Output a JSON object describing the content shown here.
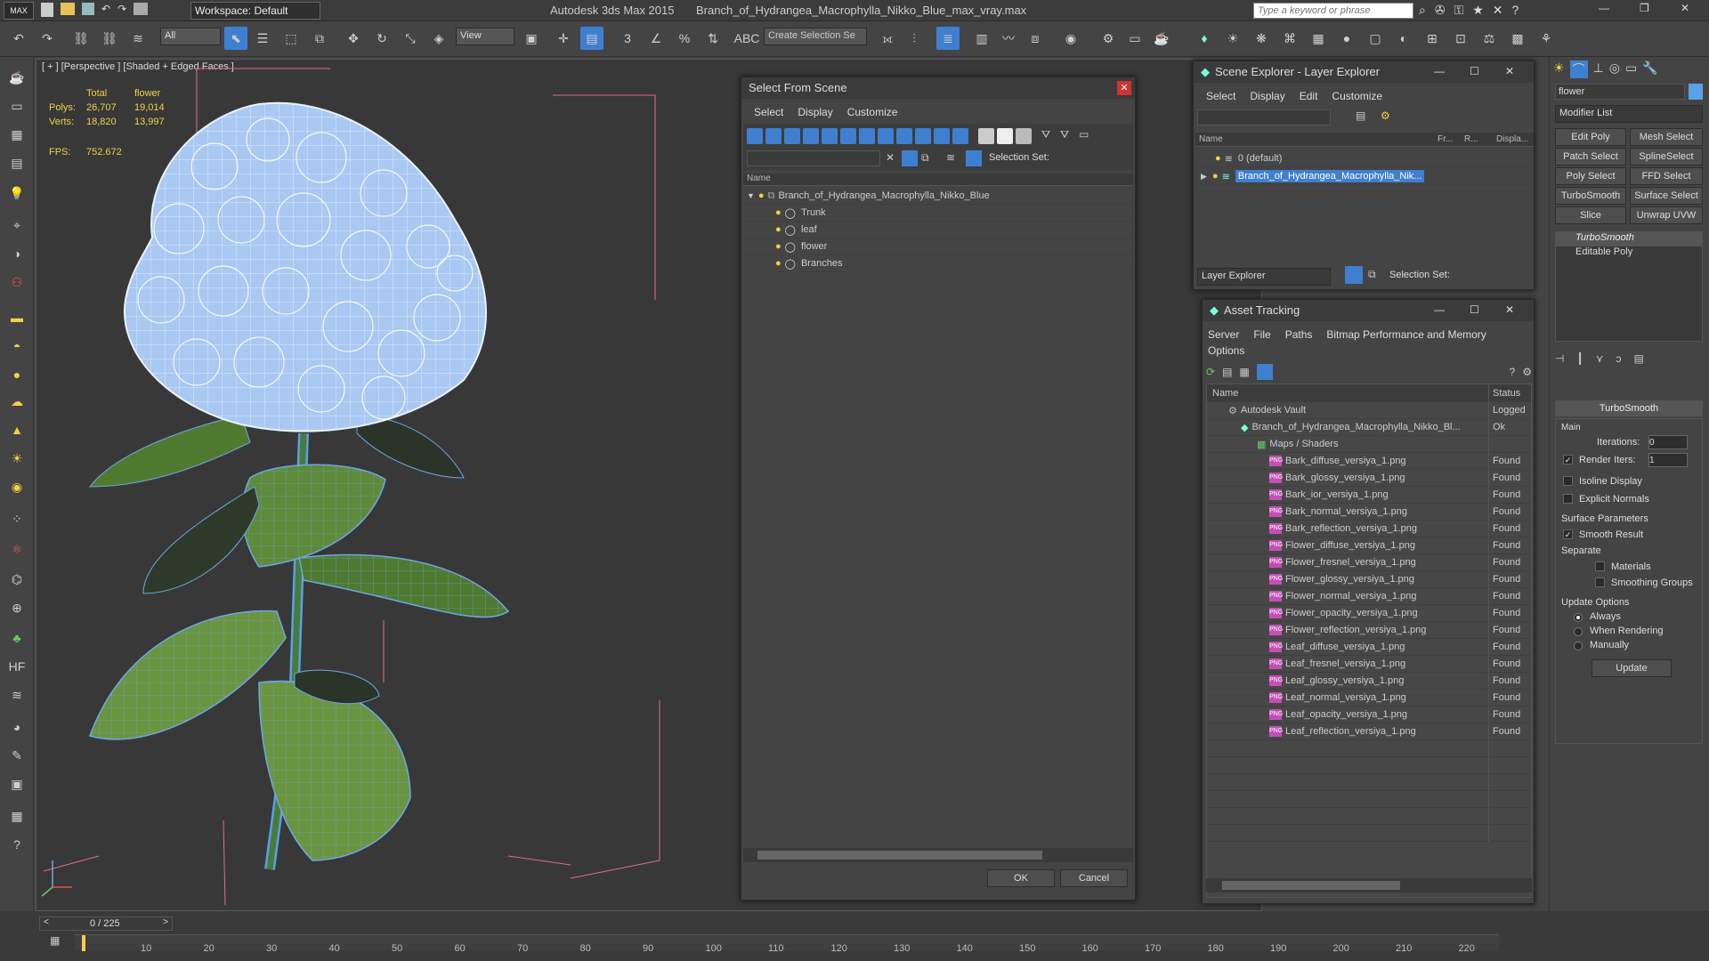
{
  "app": {
    "title": "Autodesk 3ds Max  2015",
    "file": "Branch_of_Hydrangea_Macrophylla_Nikko_Blue_max_vray.max",
    "workspace": "Workspace: Default",
    "search_placeholder": "Type a keyword or phrase",
    "logo": "MAX"
  },
  "toolbar": {
    "filter": "All",
    "view": "View",
    "create_selection": "Create Selection Se"
  },
  "viewport": {
    "label": "[ + ] [Perspective ] [Shaded + Edged Faces ]",
    "stats": {
      "col_total": "Total",
      "col_flower": "flower",
      "polys_label": "Polys:",
      "polys_total": "26,707",
      "polys_flower": "19,014",
      "verts_label": "Verts:",
      "verts_total": "18,820",
      "verts_flower": "13,997",
      "fps_label": "FPS:",
      "fps_value": "752.672"
    }
  },
  "select_from_scene": {
    "title": "Select From Scene",
    "menu": [
      "Select",
      "Display",
      "Customize"
    ],
    "selection_set_label": "Selection Set:",
    "column_name": "Name",
    "root": "Branch_of_Hydrangea_Macrophylla_Nikko_Blue",
    "children": [
      "Trunk",
      "leaf",
      "flower",
      "Branches"
    ],
    "ok": "OK",
    "cancel": "Cancel"
  },
  "scene_explorer": {
    "title": "Scene Explorer - Layer Explorer",
    "menu": [
      "Select",
      "Display",
      "Edit",
      "Customize"
    ],
    "col_name": "Name",
    "col_fr": "Fr...",
    "col_r": "R...",
    "col_disp": "Displa...",
    "rows": [
      "0 (default)",
      "Branch_of_Hydrangea_Macrophylla_Nik..."
    ],
    "footer_dropdown": "Layer Explorer",
    "selection_set_label": "Selection Set:"
  },
  "asset_tracking": {
    "title": "Asset Tracking",
    "menu": [
      "Server",
      "File",
      "Paths",
      "Bitmap Performance and Memory"
    ],
    "menu2": "Options",
    "col_name": "Name",
    "col_status": "Status",
    "vault": "Autodesk Vault",
    "vault_status": "Logged",
    "file": "Branch_of_Hydrangea_Macrophylla_Nikko_Bl...",
    "file_status": "Ok",
    "maps_group": "Maps / Shaders",
    "maps": [
      "Bark_diffuse_versiya_1.png",
      "Bark_glossy_versiya_1.png",
      "Bark_ior_versiya_1.png",
      "Bark_normal_versiya_1.png",
      "Bark_reflection_versiya_1.png",
      "Flower_diffuse_versiya_1.png",
      "Flower_fresnel_versiya_1.png",
      "Flower_glossy_versiya_1.png",
      "Flower_normal_versiya_1.png",
      "Flower_opacity_versiya_1.png",
      "Flower_reflection_versiya_1.png",
      "Leaf_diffuse_versiya_1.png",
      "Leaf_fresnel_versiya_1.png",
      "Leaf_glossy_versiya_1.png",
      "Leaf_normal_versiya_1.png",
      "Leaf_opacity_versiya_1.png",
      "Leaf_reflection_versiya_1.png"
    ],
    "found": "Found",
    "png_tag": "PNG"
  },
  "command_panel": {
    "object_name": "flower",
    "modifier_list": "Modifier List",
    "buttons": [
      "Edit Poly",
      "Mesh Select",
      "Patch Select",
      "SplineSelect",
      "Poly Select",
      "FFD Select",
      "TurboSmooth",
      "Surface Select",
      "Slice",
      "Unwrap UVW"
    ],
    "stack": [
      "TurboSmooth",
      "Editable Poly"
    ],
    "rollout_title": "TurboSmooth",
    "main_label": "Main",
    "iterations_label": "Iterations:",
    "iterations_value": "0",
    "render_iters_label": "Render Iters:",
    "render_iters_value": "1",
    "isoline": "Isoline Display",
    "explicit_normals": "Explicit Normals",
    "surface_params": "Surface Parameters",
    "smooth_result": "Smooth Result",
    "separate": "Separate",
    "materials": "Materials",
    "smoothing_groups": "Smoothing Groups",
    "update_options": "Update Options",
    "always": "Always",
    "when_rendering": "When Rendering",
    "manually": "Manually",
    "update_btn": "Update"
  },
  "timeline": {
    "frame": "0 / 225",
    "ticks": [
      "10",
      "20",
      "30",
      "40",
      "50",
      "60",
      "70",
      "80",
      "90",
      "100",
      "110",
      "120",
      "130",
      "140",
      "150",
      "160",
      "170",
      "180",
      "190",
      "200",
      "210",
      "220"
    ]
  },
  "colors": {
    "accent": "#3f7fd0",
    "stat_yellow": "#f2d04a",
    "flower_blue": "#a9c8f2",
    "leaf_green": "#5e8a3a"
  }
}
